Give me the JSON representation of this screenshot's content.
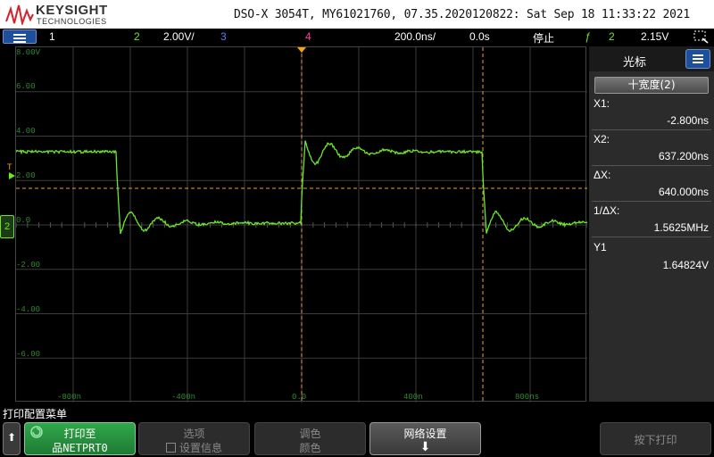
{
  "header": {
    "brand": "KEYSIGHT",
    "brand_sub": "TECHNOLOGIES",
    "model_line": "DSO-X 3054T, MY61021760, 07.35.2020120822: Sat Sep 18 11:33:22 2021"
  },
  "status_bar": {
    "ch1": "1",
    "ch2": "2",
    "ch2_scale": "2.00V/",
    "ch3": "3",
    "ch4": "4",
    "timebase": "200.0ns/",
    "delay": "0.0s",
    "run_state": "停止",
    "trigger_icon": "ƒ",
    "trigger_source": "2",
    "trigger_level": "2.15V"
  },
  "plot": {
    "y_labels": [
      "8.00V",
      "6.00",
      "4.00",
      "2.00",
      "0.0",
      "-2.00",
      "-4.00",
      "-6.00"
    ],
    "x_labels": [
      "-800n",
      "-400n",
      "0.0",
      "400n",
      "800ns"
    ],
    "trig_marker": "T",
    "ch2_marker": "2",
    "colors": {
      "trace": "#6ee62a",
      "grid": "#3c3c3c",
      "cursor": "#e8a040",
      "trigger": "#ffa500"
    }
  },
  "panel": {
    "title": "光标",
    "width_button": "⼗宽度(2)",
    "rows": [
      {
        "label": "X1:",
        "value": "-2.800ns"
      },
      {
        "label": "X2:",
        "value": "637.200ns"
      },
      {
        "label": "ΔX:",
        "value": "640.000ns"
      },
      {
        "label": "1/ΔX:",
        "value": "1.5625MHz"
      },
      {
        "label": "Y1",
        "value": "1.64824V"
      }
    ]
  },
  "bottom": {
    "menu_title": "打印配置菜单",
    "back_icon": "⬆",
    "keys": {
      "print_to": {
        "l1": "打印至",
        "l2": "品NETPRT0"
      },
      "options": {
        "l1": "选项",
        "l2": "设置信息"
      },
      "palette": {
        "l1": "调色",
        "l2": "颜色"
      },
      "network": {
        "l1": "网络设置",
        "l2": "⬇"
      },
      "press_print": {
        "l1": "按下打印"
      }
    }
  }
}
